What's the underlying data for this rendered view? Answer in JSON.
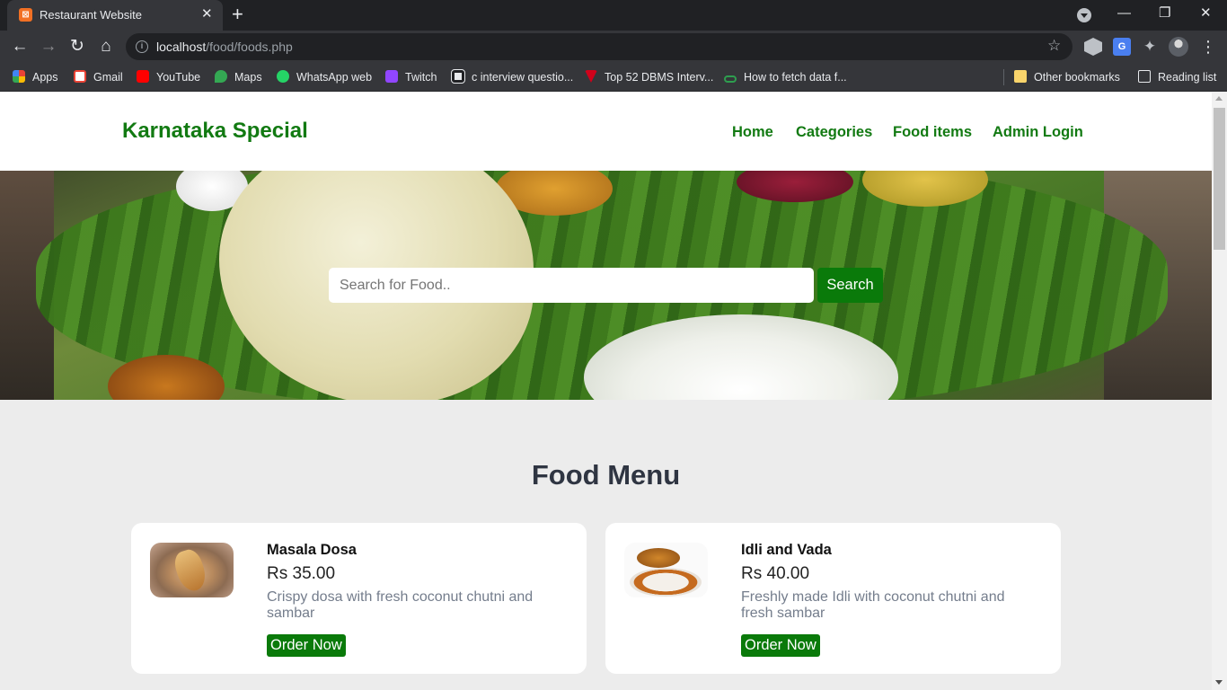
{
  "browser": {
    "tab_title": "Restaurant Website",
    "favicon_text": "⊠",
    "url_host": "localhost",
    "url_path": "/food/foods.php",
    "bookmarks": [
      {
        "label": "Apps",
        "icon": "apps-grid-icon",
        "color": "#e44d3a"
      },
      {
        "label": "Gmail",
        "icon": "gmail-icon",
        "color": "#ea4335"
      },
      {
        "label": "YouTube",
        "icon": "youtube-icon",
        "color": "#ff0000"
      },
      {
        "label": "Maps",
        "icon": "maps-icon",
        "color": "#34a853"
      },
      {
        "label": "WhatsApp web",
        "icon": "whatsapp-icon",
        "color": "#25d366"
      },
      {
        "label": "Twitch",
        "icon": "twitch-icon",
        "color": "#9146ff"
      },
      {
        "label": "c interview questio...",
        "icon": "qr-icon",
        "color": "#e8eaed"
      },
      {
        "label": "Top 52 DBMS Interv...",
        "icon": "triangle-logo-icon",
        "color": "#d0021b"
      },
      {
        "label": "How to fetch data f...",
        "icon": "link-icon",
        "color": "#2e9e4f"
      }
    ],
    "other_bookmarks": "Other bookmarks",
    "reading_list": "Reading list"
  },
  "site": {
    "brand": "Karnataka Special",
    "nav": [
      "Home",
      "Categories",
      "Food items",
      "Admin Login"
    ],
    "search_placeholder": "Search for Food..",
    "search_button": "Search",
    "section_title": "Food Menu",
    "accent_color": "#0a7a0a",
    "foods": [
      {
        "name": "Masala Dosa",
        "price": "Rs 35.00",
        "description": "Crispy dosa with fresh coconut chutni and sambar",
        "order_label": "Order Now"
      },
      {
        "name": "Idli and Vada",
        "price": "Rs 40.00",
        "description": "Freshly made Idli with coconut chutni and fresh sambar",
        "order_label": "Order Now"
      }
    ]
  }
}
